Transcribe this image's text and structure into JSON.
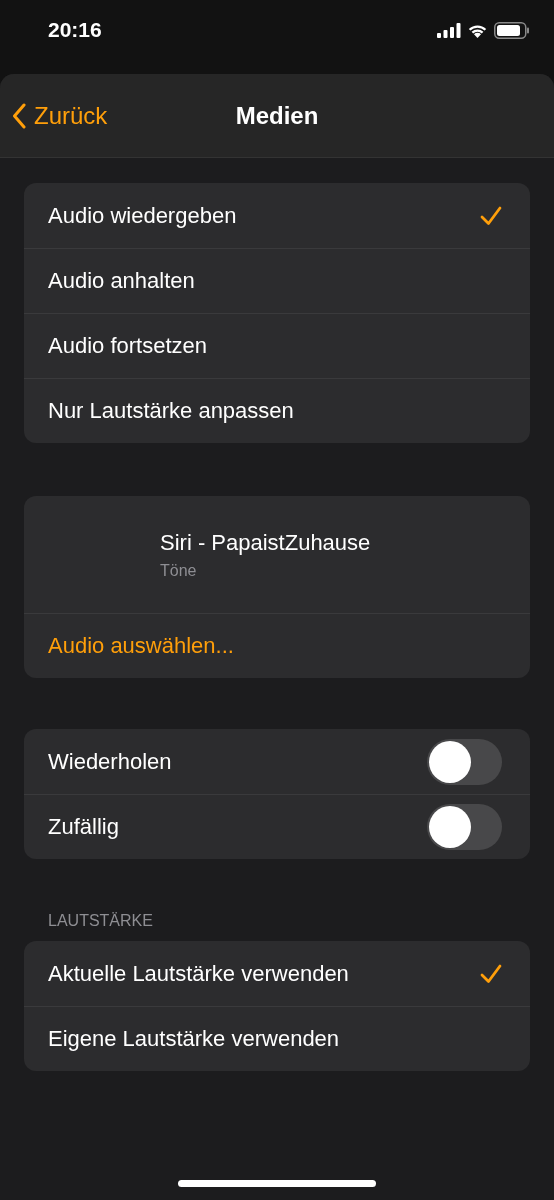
{
  "status_bar": {
    "time": "20:16"
  },
  "nav": {
    "back": "Zurück",
    "title": "Medien"
  },
  "actions": [
    {
      "label": "Audio wiedergeben",
      "selected": true
    },
    {
      "label": "Audio anhalten",
      "selected": false
    },
    {
      "label": "Audio fortsetzen",
      "selected": false
    },
    {
      "label": "Nur Lautstärke anpassen",
      "selected": false
    }
  ],
  "media": {
    "title": "Siri - PapaistZuhause",
    "subtitle": "Töne",
    "choose": "Audio auswählen..."
  },
  "toggles": [
    {
      "label": "Wiederholen",
      "on": false
    },
    {
      "label": "Zufällig",
      "on": false
    }
  ],
  "volume": {
    "header": "LAUTSTÄRKE",
    "options": [
      {
        "label": "Aktuelle Lautstärke verwenden",
        "selected": true
      },
      {
        "label": "Eigene Lautstärke verwenden",
        "selected": false
      }
    ]
  }
}
